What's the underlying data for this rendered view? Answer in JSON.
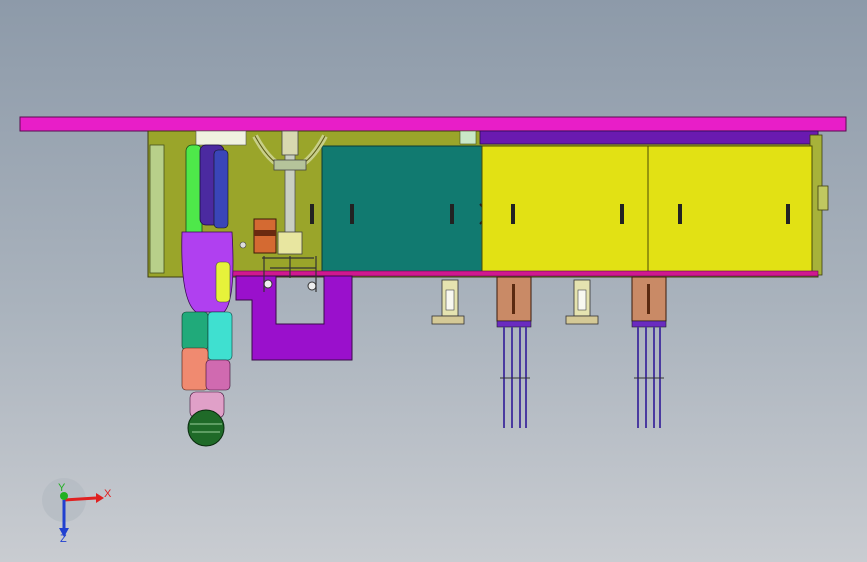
{
  "triad": {
    "x_label": "X",
    "y_label": "Y",
    "z_label": "Z",
    "x_color": "#e02020",
    "y_color": "#20b020",
    "z_color": "#2040d0"
  },
  "colors": {
    "top_plate": "#e81ec8",
    "frame": "#9aa52a",
    "teal_cabinet": "#117a70",
    "yellow_cabinet": "#e2e114",
    "purple_base": "#9a10cc",
    "copper_block": "#c98a66"
  }
}
